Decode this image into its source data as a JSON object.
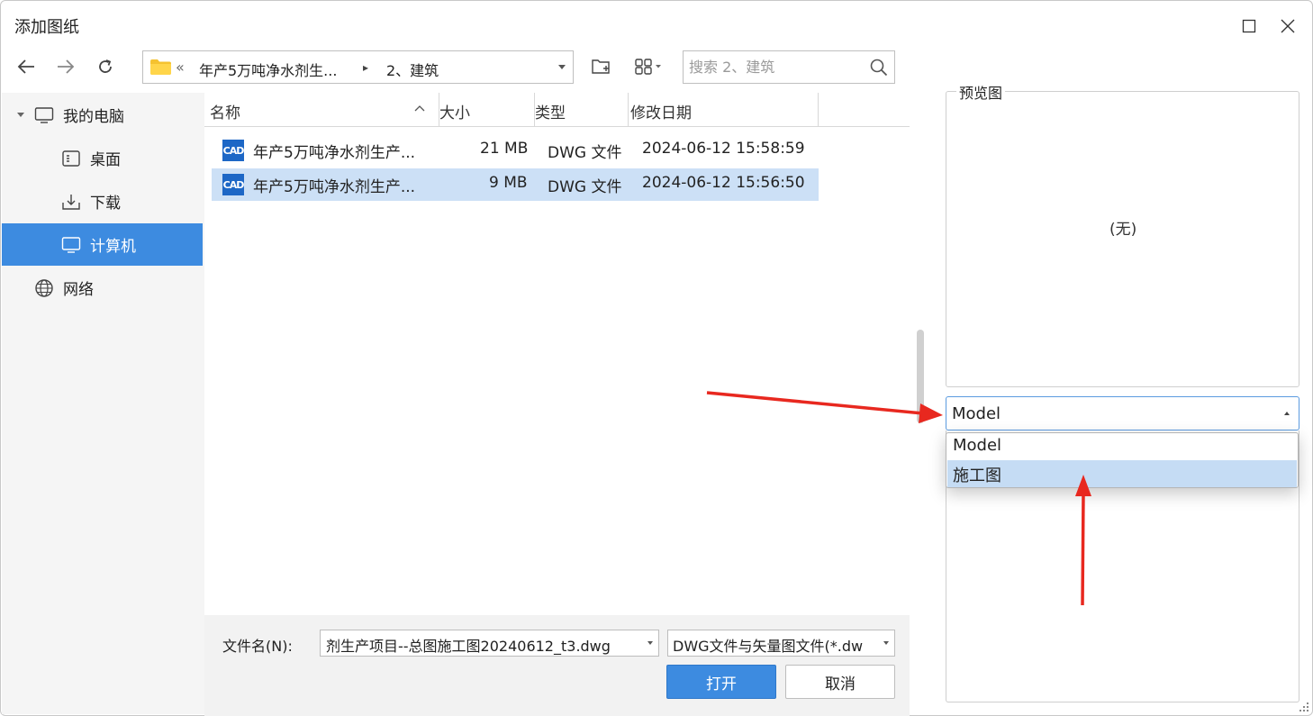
{
  "window": {
    "title": "添加图纸",
    "maximize_icon": "maximize-icon",
    "close_icon": "close-icon"
  },
  "toolbar": {
    "back_icon": "arrow-left-icon",
    "forward_icon": "arrow-right-icon",
    "refresh_icon": "refresh-icon",
    "breadcrumb_prefix": "«",
    "breadcrumb_parent": "年产5万吨净水剂生...",
    "breadcrumb_sep": "▸",
    "breadcrumb_current": "2、建筑",
    "new_folder_icon": "new-folder-icon",
    "view_icon": "grid-view-icon",
    "search_placeholder": "搜索 2、建筑"
  },
  "sidebar": {
    "items": [
      {
        "label": "我的电脑",
        "icon": "monitor-icon",
        "expanded": true
      },
      {
        "label": "桌面",
        "icon": "desktop-icon"
      },
      {
        "label": "下载",
        "icon": "download-icon"
      },
      {
        "label": "计算机",
        "icon": "computer-icon",
        "selected": true
      },
      {
        "label": "网络",
        "icon": "globe-icon"
      }
    ]
  },
  "file_list": {
    "columns": [
      "名称",
      "大小",
      "类型",
      "修改日期"
    ],
    "rows": [
      {
        "name": "年产5万吨净水剂生产...",
        "size": "21 MB",
        "type": "DWG 文件",
        "date": "2024-06-12 15:58:59",
        "icon": "CAD"
      },
      {
        "name": "年产5万吨净水剂生产...",
        "size": "9 MB",
        "type": "DWG 文件",
        "date": "2024-06-12 15:56:50",
        "icon": "CAD",
        "selected": true
      }
    ]
  },
  "bottom": {
    "filename_label": "文件名(N):",
    "filename_value": "剂生产项目--总图施工图20240612_t3.dwg",
    "filetype_value": "DWG文件与矢量图文件(*.dw",
    "open_label": "打开",
    "cancel_label": "取消"
  },
  "preview": {
    "title": "预览图",
    "empty_text": "(无)",
    "layout_selected": "Model",
    "layout_options": [
      "Model",
      "施工图"
    ],
    "highlighted_option": "施工图"
  },
  "colors": {
    "accent": "#3d8be0",
    "row_selected": "#cce0f6",
    "annotation_arrow": "#e8281f"
  }
}
